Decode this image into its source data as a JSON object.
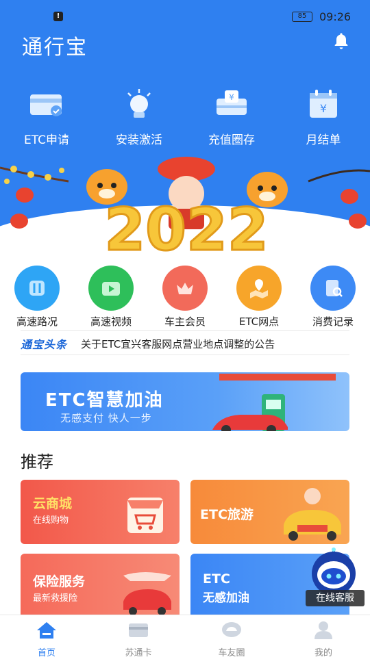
{
  "status": {
    "battery": "85",
    "time": "09:26"
  },
  "header": {
    "app_title": "通行宝"
  },
  "quick_actions": [
    {
      "label": "ETC申请",
      "icon": "etc-card-icon"
    },
    {
      "label": "安装激活",
      "icon": "lightbulb-icon"
    },
    {
      "label": "充值圈存",
      "icon": "recharge-icon"
    },
    {
      "label": "月结单",
      "icon": "calendar-bill-icon"
    }
  ],
  "banner": {
    "year_text": "2022"
  },
  "services": [
    {
      "label": "高速路况",
      "color": "#2ea5f5",
      "icon": "road-icon"
    },
    {
      "label": "高速视频",
      "color": "#2ebf5a",
      "icon": "video-icon"
    },
    {
      "label": "车主会员",
      "color": "#f26a5a",
      "icon": "crown-icon"
    },
    {
      "label": "ETC网点",
      "color": "#f7a52a",
      "icon": "map-location-icon"
    },
    {
      "label": "消费记录",
      "color": "#3d8af5",
      "icon": "receipt-search-icon"
    }
  ],
  "news": {
    "tag": "通宝头条",
    "text": "关于ETC宜兴客服网点营业地点调整的公告"
  },
  "promo": {
    "title": "ETC智慧加油",
    "subtitle": "无感支付  快人一步"
  },
  "recommend": {
    "title": "推荐",
    "cards": [
      {
        "title": "云商城",
        "subtitle": "在线购物"
      },
      {
        "title": "ETC旅游",
        "subtitle": ""
      },
      {
        "title": "保险服务",
        "subtitle": "最新救援险"
      },
      {
        "title": "ETC",
        "subtitle": "无感加油"
      }
    ]
  },
  "support": {
    "label": "在线客服"
  },
  "tabs": [
    {
      "label": "首页",
      "active": true
    },
    {
      "label": "苏通卡",
      "active": false
    },
    {
      "label": "车友圈",
      "active": false
    },
    {
      "label": "我的",
      "active": false
    }
  ],
  "colors": {
    "primary": "#2f80f0",
    "orange": "#f78a3a",
    "red": "#f2584a"
  }
}
